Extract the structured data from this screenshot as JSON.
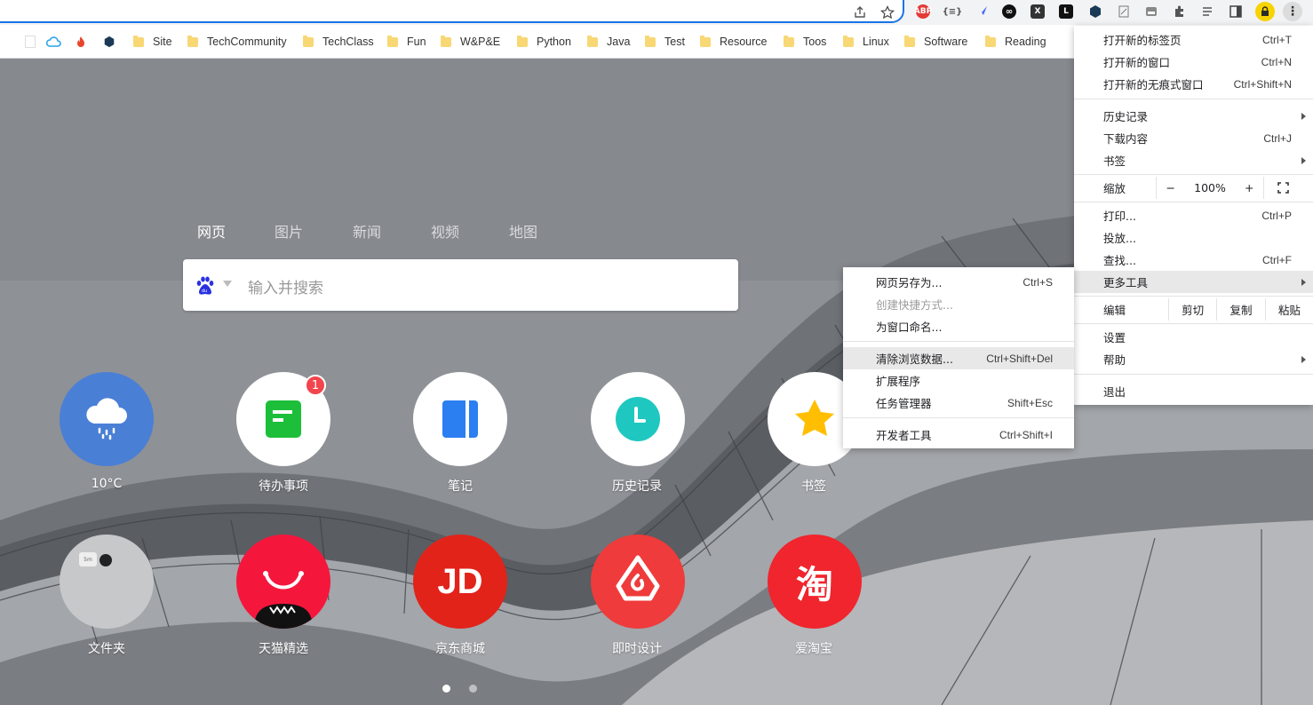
{
  "extensions": [
    "ABP",
    "{≡}"
  ],
  "bookmarks": [
    "Site",
    "TechCommunity",
    "TechClass",
    "Fun",
    "W&P&E",
    "Python",
    "Java",
    "Test",
    "Resource",
    "Toos",
    "Linux",
    "Software",
    "Reading"
  ],
  "search": {
    "tabs": [
      "网页",
      "图片",
      "新闻",
      "视频",
      "地图"
    ],
    "placeholder": "输入并搜索"
  },
  "tiles": [
    {
      "label": "10°C",
      "icon": "weather-cloud-icon"
    },
    {
      "label": "待办事项",
      "icon": "todo-icon",
      "badge": "1"
    },
    {
      "label": "笔记",
      "icon": "notes-icon"
    },
    {
      "label": "历史记录",
      "icon": "history-clock-icon"
    },
    {
      "label": "书签",
      "icon": "bookmark-star-icon"
    },
    {
      "label": "文件夹",
      "icon": "folder-icon"
    },
    {
      "label": "天猫精选",
      "icon": "tmall-icon"
    },
    {
      "label": "京东商城",
      "icon": "jd-icon",
      "text": "JD"
    },
    {
      "label": "即时设计",
      "icon": "jishi-design-icon"
    },
    {
      "label": "爱淘宝",
      "icon": "taobao-icon",
      "text": "淘"
    }
  ],
  "chrome_menu": {
    "new_tab": {
      "label": "打开新的标签页",
      "shortcut": "Ctrl+T"
    },
    "new_window": {
      "label": "打开新的窗口",
      "shortcut": "Ctrl+N"
    },
    "incognito": {
      "label": "打开新的无痕式窗口",
      "shortcut": "Ctrl+Shift+N"
    },
    "history": {
      "label": "历史记录"
    },
    "downloads": {
      "label": "下载内容",
      "shortcut": "Ctrl+J"
    },
    "bookmarks": {
      "label": "书签"
    },
    "zoom": {
      "label": "缩放",
      "minus": "−",
      "value": "100%",
      "plus": "+"
    },
    "print": {
      "label": "打印...",
      "shortcut": "Ctrl+P"
    },
    "cast": {
      "label": "投放..."
    },
    "find": {
      "label": "查找...",
      "shortcut": "Ctrl+F"
    },
    "more_tools": {
      "label": "更多工具"
    },
    "edit": {
      "label": "编辑",
      "cut": "剪切",
      "copy": "复制",
      "paste": "粘贴"
    },
    "settings": {
      "label": "设置"
    },
    "help": {
      "label": "帮助"
    },
    "exit": {
      "label": "退出"
    }
  },
  "more_tools_menu": {
    "save_page": {
      "label": "网页另存为...",
      "shortcut": "Ctrl+S"
    },
    "create_shortcut": {
      "label": "创建快捷方式..."
    },
    "name_window": {
      "label": "为窗口命名..."
    },
    "clear_data": {
      "label": "清除浏览数据...",
      "shortcut": "Ctrl+Shift+Del"
    },
    "extensions": {
      "label": "扩展程序"
    },
    "task_manager": {
      "label": "任务管理器",
      "shortcut": "Shift+Esc"
    },
    "dev_tools": {
      "label": "开发者工具",
      "shortcut": "Ctrl+Shift+I"
    }
  },
  "colors": {
    "accent": "#1a73e8",
    "weather": "#4a7fd6",
    "todo": "#1dbf3a",
    "notes": "#2b7ff0",
    "history": "#1ec8c0",
    "star": "#ffbf00",
    "tmall": "#f5163c",
    "jd": "#e2231a",
    "jishi": "#ef3b3b",
    "taobao": "#f0252d"
  }
}
